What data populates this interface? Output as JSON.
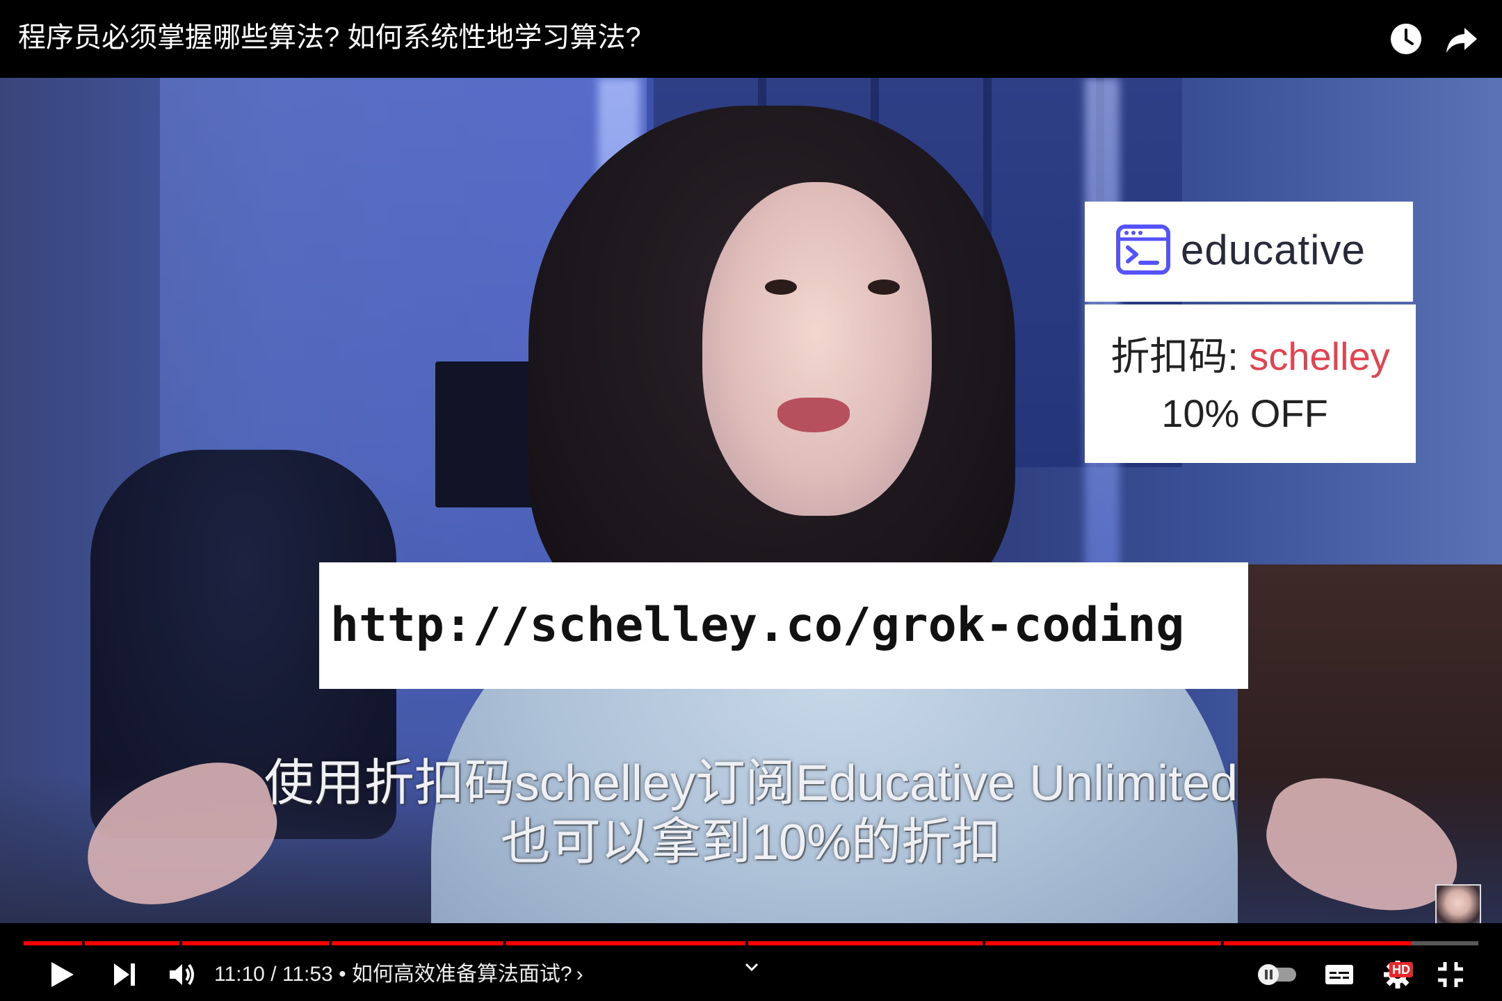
{
  "header": {
    "video_title": "程序员必须掌握哪些算法? 如何系统性地学习算法?",
    "watch_later_icon": "clock-icon",
    "share_icon": "share-arrow-icon"
  },
  "overlays": {
    "logo_text": "educative",
    "promo_label": "折扣码: ",
    "promo_code": "schelley",
    "promo_discount": "10% OFF",
    "url": "http://schelley.co/grok-coding",
    "promo_code_color": "#e2444f"
  },
  "subtitles": {
    "line1": "使用折扣码schelley订阅Educative Unlimited",
    "line2": "也可以拿到10%的折扣"
  },
  "player": {
    "current_time": "11:10",
    "separator": " / ",
    "total_time": "11:53",
    "chapter_prefix": " • ",
    "chapter_title": "如何高效准备算法面试?",
    "chapter_chevron": "›",
    "progress_fraction": 0.954,
    "hd_label": "HD",
    "accent_color": "#ff0000",
    "chapter_markers": [
      0.04,
      0.107,
      0.21,
      0.33,
      0.496,
      0.659,
      0.823
    ]
  }
}
